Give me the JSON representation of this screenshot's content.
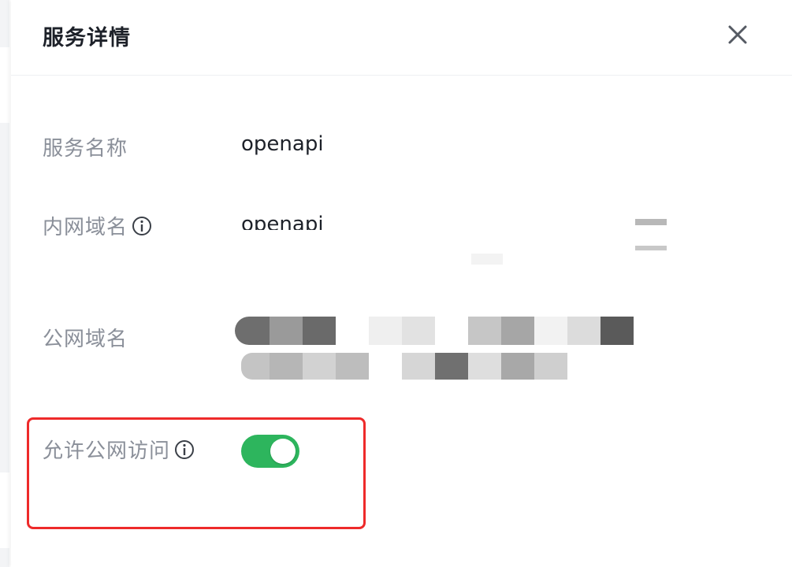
{
  "drawer": {
    "title": "服务详情"
  },
  "fields": {
    "service_name": {
      "label": "服务名称",
      "value": "openapi"
    },
    "intranet_domain": {
      "label": "内网域名",
      "value_visible": "openapi"
    },
    "public_domain": {
      "label": "公网域名"
    },
    "allow_public_access": {
      "label": "允许公网访问",
      "enabled": true
    }
  },
  "colors": {
    "toggle_on": "#2db55d",
    "highlight": "#ee2a2a",
    "label": "#8a8f99"
  }
}
